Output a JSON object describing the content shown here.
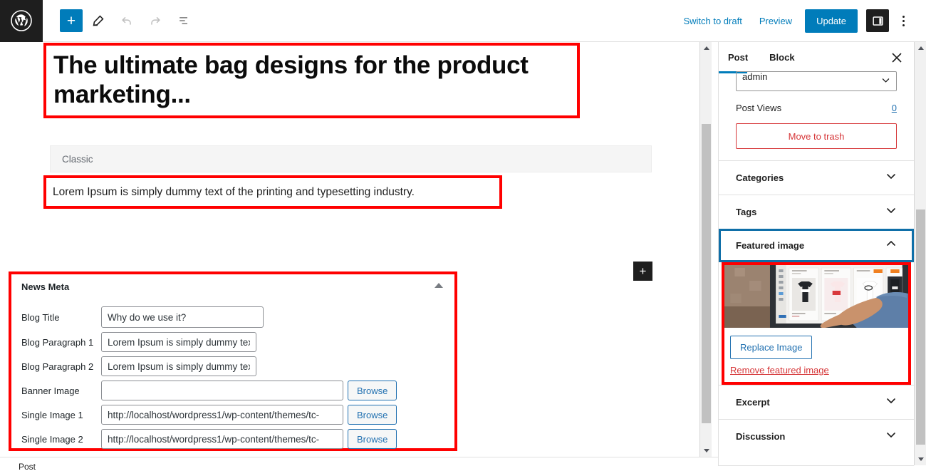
{
  "toolbar": {
    "logo_icon": "wordpress-logo-icon",
    "add_label": "+",
    "add_icon": "plus-icon",
    "edit_icon": "pencil-icon",
    "undo_icon": "undo-icon",
    "redo_icon": "redo-icon",
    "list_view_icon": "list-view-icon",
    "switch_to_draft": "Switch to draft",
    "preview": "Preview",
    "update": "Update",
    "settings_icon": "sidebar-panel-icon",
    "options_icon": "kebab-menu-icon"
  },
  "editor": {
    "post_title": "The ultimate bag designs for the product marketing...",
    "classic_block_label": "Classic",
    "paragraph": "Lorem Ipsum is simply dummy text of the printing and typesetting industry.",
    "inserter_label": "+",
    "inserter_icon": "plus-icon"
  },
  "meta_box": {
    "title": "News Meta",
    "collapse_icon": "triangle-up-icon",
    "fields": [
      {
        "label": "Blog Title",
        "value": "Why do we use it?",
        "browse": null,
        "size": "title"
      },
      {
        "label": "Blog Paragraph 1",
        "value": "Lorem Ipsum is simply dummy tex",
        "browse": null,
        "size": "para"
      },
      {
        "label": "Blog Paragraph 2",
        "value": "Lorem Ipsum is simply dummy tex",
        "browse": null,
        "size": "para"
      },
      {
        "label": "Banner Image",
        "value": "",
        "browse": "Browse",
        "size": "wide"
      },
      {
        "label": "Single Image 1",
        "value": "http://localhost/wordpress1/wp-content/themes/tc-",
        "browse": "Browse",
        "size": "wide"
      },
      {
        "label": "Single Image 2",
        "value": "http://localhost/wordpress1/wp-content/themes/tc-",
        "browse": "Browse",
        "size": "wide"
      }
    ]
  },
  "sidebar": {
    "tab_post": "Post",
    "tab_block": "Block",
    "close_icon": "close-icon",
    "author_value": "admin",
    "author_chevron_icon": "chevron-down-icon",
    "post_views_label": "Post Views",
    "post_views_count": "0",
    "move_to_trash": "Move to trash",
    "panels": [
      {
        "label": "Categories",
        "icon": "chevron-down-icon",
        "expanded": false
      },
      {
        "label": "Tags",
        "icon": "chevron-down-icon",
        "expanded": false
      },
      {
        "label": "Featured image",
        "icon": "chevron-up-icon",
        "expanded": true
      },
      {
        "label": "Excerpt",
        "icon": "chevron-down-icon",
        "expanded": false
      },
      {
        "label": "Discussion",
        "icon": "chevron-down-icon",
        "expanded": false
      }
    ],
    "featured_image_alt": "Person pointing at screen showing t-shirt product listings",
    "replace_image": "Replace Image",
    "remove_featured_image": "Remove featured image"
  },
  "bottom": {
    "breadcrumb": "Post"
  },
  "colors": {
    "accent_blue": "#007cba",
    "link_blue": "#2271b1",
    "annotation_red": "#ff0000",
    "annotation_blue": "#0f6fa8",
    "danger_red": "#d63638",
    "dark": "#1e1e1e"
  }
}
